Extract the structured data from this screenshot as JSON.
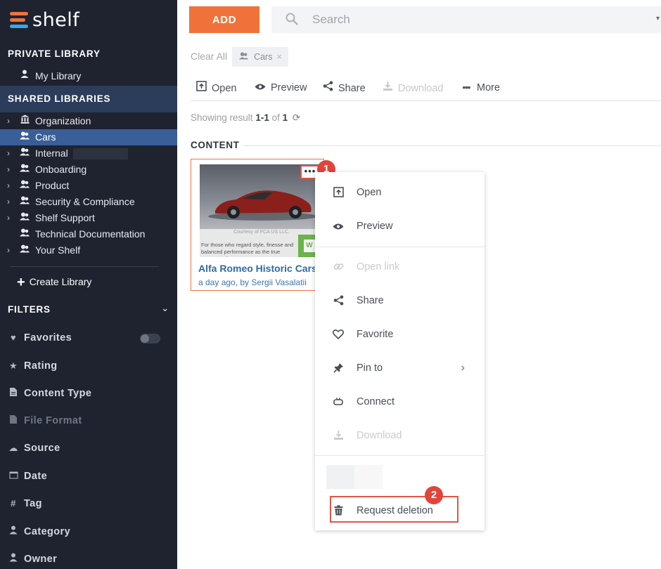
{
  "app": {
    "logo_text": "shelf"
  },
  "sidebar": {
    "private_title": "PRIVATE LIBRARY",
    "my_library": "My Library",
    "shared_title": "SHARED LIBRARIES",
    "libraries": [
      {
        "label": "Organization",
        "icon": "institution-icon"
      },
      {
        "label": "Cars",
        "icon": "users-icon"
      },
      {
        "label": "Internal",
        "icon": "users-icon"
      },
      {
        "label": "Onboarding",
        "icon": "users-icon"
      },
      {
        "label": "Product",
        "icon": "users-icon"
      },
      {
        "label": "Security & Compliance",
        "icon": "users-icon"
      },
      {
        "label": "Shelf Support",
        "icon": "users-icon"
      },
      {
        "label": "Technical Documentation",
        "icon": "users-icon"
      },
      {
        "label": "Your Shelf",
        "icon": "users-icon"
      }
    ],
    "create_library": "Create Library",
    "filters_title": "FILTERS",
    "filters": [
      {
        "label": "Favorites",
        "icon": "heart-icon"
      },
      {
        "label": "Rating",
        "icon": "star-icon"
      },
      {
        "label": "Content Type",
        "icon": "document-icon"
      },
      {
        "label": "File Format",
        "icon": "file-icon"
      },
      {
        "label": "Source",
        "icon": "cloud-icon"
      },
      {
        "label": "Date",
        "icon": "calendar-icon"
      },
      {
        "label": "Tag",
        "icon": "hash-icon"
      },
      {
        "label": "Category",
        "icon": "category-icon"
      },
      {
        "label": "Owner",
        "icon": "user-icon"
      }
    ]
  },
  "header": {
    "add_label": "ADD",
    "search_placeholder": "Search"
  },
  "filter_bar": {
    "clear_all": "Clear All",
    "chip_label": "Cars"
  },
  "toolbar": {
    "open": "Open",
    "preview": "Preview",
    "share": "Share",
    "download": "Download",
    "more": "More"
  },
  "results": {
    "prefix": "Showing result ",
    "range": "1-1",
    "of": " of ",
    "total": "1"
  },
  "content_heading": "CONTENT",
  "card": {
    "thumb_caption": "Courtesy of FCA US LLC.",
    "thumb_text": "For those who regard style, finesse and balanced performance as the true measure of...",
    "thumb_badge": "W",
    "title": "Alfa Romeo Historic Cars",
    "meta": "a day ago, by Sergii Vasalatii",
    "dots": "•••"
  },
  "context_menu": {
    "open": "Open",
    "preview": "Preview",
    "open_link": "Open link",
    "share": "Share",
    "favorite": "Favorite",
    "pin_to": "Pin to",
    "connect": "Connect",
    "download": "Download",
    "request_deletion": "Request deletion"
  },
  "annotations": {
    "step1": "1",
    "step2": "2"
  },
  "colors": {
    "accent": "#f0723a",
    "sidebar_bg": "#1f2330",
    "active_item": "#3a5e97",
    "annotation_red": "#e05548"
  }
}
